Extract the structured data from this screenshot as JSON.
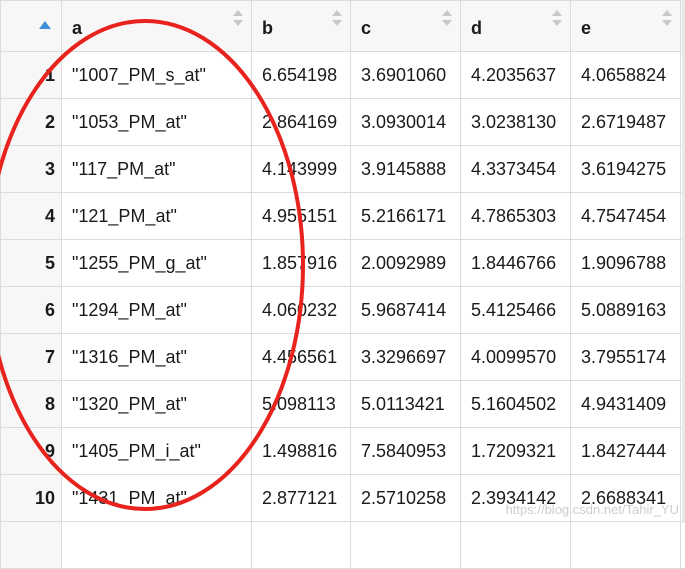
{
  "table": {
    "columns": [
      "a",
      "b",
      "c",
      "d",
      "e"
    ],
    "rows": [
      {
        "index": "1",
        "a": "\"1007_PM_s_at\"",
        "b": "6.654198",
        "c": "3.6901060",
        "d": "4.2035637",
        "e": "4.0658824"
      },
      {
        "index": "2",
        "a": "\"1053_PM_at\"",
        "b": "2.864169",
        "c": "3.0930014",
        "d": "3.0238130",
        "e": "2.6719487"
      },
      {
        "index": "3",
        "a": "\"117_PM_at\"",
        "b": "4.143999",
        "c": "3.9145888",
        "d": "4.3373454",
        "e": "3.6194275"
      },
      {
        "index": "4",
        "a": "\"121_PM_at\"",
        "b": "4.955151",
        "c": "5.2166171",
        "d": "4.7865303",
        "e": "4.7547454"
      },
      {
        "index": "5",
        "a": "\"1255_PM_g_at\"",
        "b": "1.857916",
        "c": "2.0092989",
        "d": "1.8446766",
        "e": "1.9096788"
      },
      {
        "index": "6",
        "a": "\"1294_PM_at\"",
        "b": "4.060232",
        "c": "5.9687414",
        "d": "5.4125466",
        "e": "5.0889163"
      },
      {
        "index": "7",
        "a": "\"1316_PM_at\"",
        "b": "4.456561",
        "c": "3.3296697",
        "d": "4.0099570",
        "e": "3.7955174"
      },
      {
        "index": "8",
        "a": "\"1320_PM_at\"",
        "b": "5.098113",
        "c": "5.0113421",
        "d": "5.1604502",
        "e": "4.9431409"
      },
      {
        "index": "9",
        "a": "\"1405_PM_i_at\"",
        "b": "1.498816",
        "c": "7.5840953",
        "d": "1.7209321",
        "e": "1.8427444"
      },
      {
        "index": "10",
        "a": "\"1431_PM_at\"",
        "b": "2.877121",
        "c": "2.5710258",
        "d": "2.3934142",
        "e": "2.6688341"
      }
    ]
  },
  "icons": {
    "sort_active": "sort-ascending-icon",
    "sort_inactive": "sort-both-icon"
  },
  "colors": {
    "annotation": "#e8231e",
    "sort_active": "#3d8fd8",
    "sort_inactive": "#c8c8c8",
    "header_bg": "#f7f7f7",
    "grid_line": "#dcdcdc"
  },
  "watermark": "https://blog.csdn.net/Tahir_YU"
}
